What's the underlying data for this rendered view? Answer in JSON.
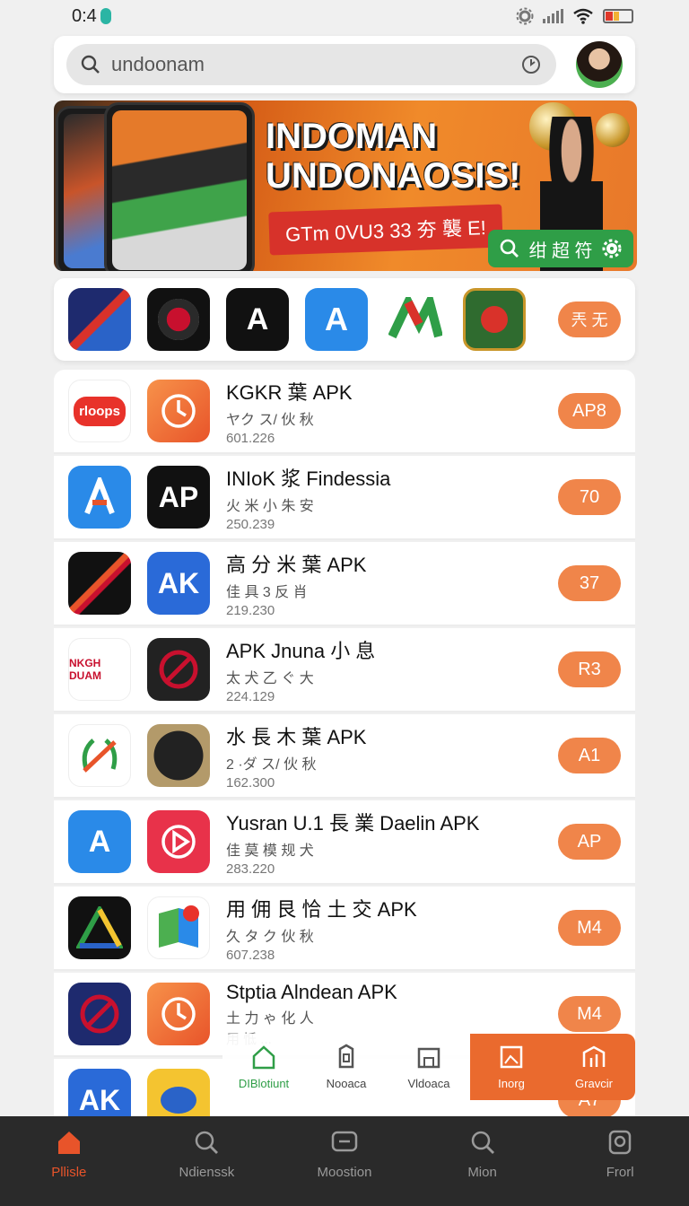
{
  "status_bar": {
    "time": "0:4"
  },
  "search": {
    "value": "undoonam"
  },
  "banner": {
    "title_line1": "INDOMAN",
    "title_line2": "UNDONAOSIS!",
    "promo_text": "GTm 0VU3 33 夯 襲 E!",
    "action_label": "绀 超 符"
  },
  "icon_strip": {
    "more_label": "兲 无"
  },
  "apps": [
    {
      "name": "KGKR 葉 APK",
      "sub": "ヤク ス/ 伙 秋",
      "count": "601.226",
      "badge": "AP8",
      "icon1": "msg-red",
      "icon2": "clock-orange"
    },
    {
      "name": "INIoK 浆 Findessia",
      "sub": "火 米 小 朱 安",
      "count": "250.239",
      "badge": "70",
      "icon1": "a-blue",
      "icon2": "ap-black"
    },
    {
      "name": "高 分 米 葉 APK",
      "sub": "佳 具 3 反 肖",
      "count": "219.230",
      "badge": "37",
      "icon1": "stripe-dark",
      "icon2": "ak-blue"
    },
    {
      "name": "APK Jnuna 小 息",
      "sub": "太 犬 乙 ぐ 大",
      "count": "224.129",
      "badge": "R3",
      "icon1": "fighter-white",
      "icon2": "slash-dark"
    },
    {
      "name": "水 長 木 葉 APK",
      "sub": "2 ·ダ ス/ 伙 秋",
      "count": "162.300",
      "badge": "A1",
      "icon1": "wreath-white",
      "icon2": "eagle-dark"
    },
    {
      "name": "Yusran U.1 長 業 Daelin APK",
      "sub": "佳 莫 模 规 犬",
      "count": "283.220",
      "badge": "AP",
      "icon1": "a-tile-blue",
      "icon2": "play-red"
    },
    {
      "name": "用 佣 艮 恰 土 交 APK",
      "sub": "久 タ ク 伙 秋",
      "count": "607.238",
      "badge": "M4",
      "icon1": "a-triangle",
      "icon2": "maps-x"
    },
    {
      "name": "Stptia Alndean APK",
      "sub": "土 力 ゃ 化 人",
      "count": "用 怟 ...",
      "badge": "M4",
      "icon1": "slash-navy",
      "icon2": "clock-orange"
    },
    {
      "name": "",
      "sub": "",
      "count": "",
      "badge": "A7",
      "icon1": "ak-blue",
      "icon2": "tiger-gold"
    }
  ],
  "floating_tabs": [
    {
      "label": "DIBlotiunt",
      "icon": "home-icon",
      "style": "green"
    },
    {
      "label": "Nooaca",
      "icon": "tag-icon",
      "style": "plain"
    },
    {
      "label": "Vldoaca",
      "icon": "folder-icon",
      "style": "plain"
    },
    {
      "label": "Inorg",
      "icon": "image-icon",
      "style": "orange"
    },
    {
      "label": "Gravcir",
      "icon": "chart-icon",
      "style": "orange"
    }
  ],
  "bottom_nav": [
    {
      "label": "Pllisle",
      "icon": "home-icon",
      "active": true
    },
    {
      "label": "Ndienssk",
      "icon": "search-icon",
      "active": false
    },
    {
      "label": "Moostion",
      "icon": "chat-icon",
      "active": false
    },
    {
      "label": "Mion",
      "icon": "search-icon",
      "active": false
    },
    {
      "label": "Frorl",
      "icon": "profile-icon",
      "active": false
    }
  ],
  "colors": {
    "accent": "#f0854a",
    "nav_active": "#e8542a",
    "green": "#2f9e47",
    "nav_bg": "#2a2a2a"
  }
}
